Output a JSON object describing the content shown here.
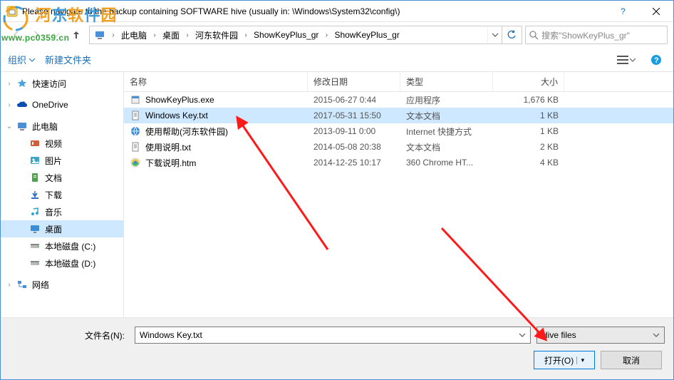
{
  "window": {
    "title": "Please navigate to the backup containing SOFTWARE hive (usually in: \\Windows\\System32\\config\\)"
  },
  "breadcrumb": {
    "root_label": "此电脑",
    "segments": [
      "桌面",
      "河东软件园",
      "ShowKeyPlus_gr",
      "ShowKeyPlus_gr"
    ]
  },
  "search": {
    "placeholder": "搜索\"ShowKeyPlus_gr\""
  },
  "toolbar": {
    "organize": "组织",
    "newfolder": "新建文件夹"
  },
  "sidebar": {
    "quick": "快速访问",
    "onedrive": "OneDrive",
    "thispc": "此电脑",
    "items": [
      {
        "label": "视频",
        "icon": "video"
      },
      {
        "label": "图片",
        "icon": "picture"
      },
      {
        "label": "文档",
        "icon": "document"
      },
      {
        "label": "下载",
        "icon": "download"
      },
      {
        "label": "音乐",
        "icon": "music"
      },
      {
        "label": "桌面",
        "icon": "desktop"
      },
      {
        "label": "本地磁盘 (C:)",
        "icon": "disk"
      },
      {
        "label": "本地磁盘 (D:)",
        "icon": "disk"
      }
    ],
    "network": "网络"
  },
  "columns": {
    "name": "名称",
    "date": "修改日期",
    "type": "类型",
    "size": "大小"
  },
  "files": [
    {
      "name": "ShowKeyPlus.exe",
      "date": "2015-06-27 0:44",
      "type": "应用程序",
      "size": "1,676 KB",
      "icon": "exe"
    },
    {
      "name": "Windows Key.txt",
      "date": "2017-05-31 15:50",
      "type": "文本文档",
      "size": "1 KB",
      "icon": "txt",
      "selected": true
    },
    {
      "name": "使用帮助(河东软件园)",
      "date": "2013-09-11 0:00",
      "type": "Internet 快捷方式",
      "size": "1 KB",
      "icon": "url"
    },
    {
      "name": "使用说明.txt",
      "date": "2014-05-08 20:38",
      "type": "文本文档",
      "size": "2 KB",
      "icon": "txt"
    },
    {
      "name": "下载说明.htm",
      "date": "2014-12-25 10:17",
      "type": "360 Chrome HT...",
      "size": "4 KB",
      "icon": "htm"
    }
  ],
  "footer": {
    "filename_label": "文件名(N):",
    "filename_value": "Windows Key.txt",
    "filter": "Hive files",
    "open": "打开(O)",
    "cancel": "取消"
  },
  "watermark": {
    "line1": "河东软件园",
    "line2": "www.pc0359.cn"
  }
}
